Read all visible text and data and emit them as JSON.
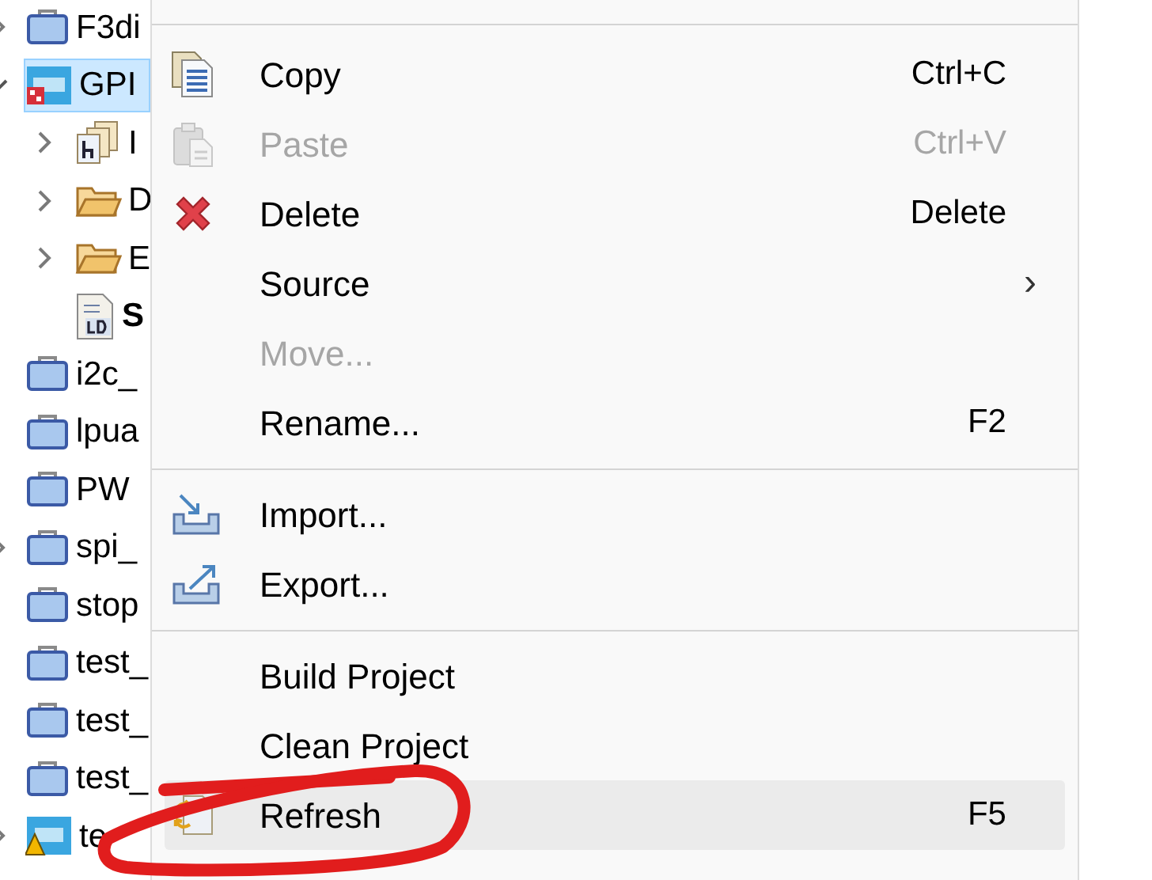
{
  "tree": [
    {
      "label": "F3di",
      "kind": "project",
      "expanded": false
    },
    {
      "label": "GPI",
      "kind": "ide",
      "expanded": true,
      "selected": true,
      "children": [
        {
          "label": "I",
          "kind": "headers",
          "expanded": false
        },
        {
          "label": "D",
          "kind": "folder",
          "expanded": false
        },
        {
          "label": "E",
          "kind": "folder",
          "expanded": false
        },
        {
          "label": "S",
          "kind": "ldfile"
        }
      ]
    },
    {
      "label": "i2c_",
      "kind": "project"
    },
    {
      "label": "lpua",
      "kind": "project"
    },
    {
      "label": "PW",
      "kind": "project"
    },
    {
      "label": "spi_",
      "kind": "project",
      "expanded": false
    },
    {
      "label": "stop",
      "kind": "project"
    },
    {
      "label": "test_",
      "kind": "project"
    },
    {
      "label": "test_",
      "kind": "project"
    },
    {
      "label": "test_",
      "kind": "project"
    },
    {
      "label": "te",
      "kind": "ide_warning",
      "expanded": false
    }
  ],
  "context_menu": [
    {
      "kind": "item",
      "label": "Copy",
      "shortcut": "Ctrl+C",
      "disabled": false,
      "selected": false
    },
    {
      "kind": "item",
      "label": "Paste",
      "shortcut": "Ctrl+V",
      "disabled": true,
      "selected": false
    },
    {
      "kind": "item",
      "label": "Delete",
      "shortcut": "Delete",
      "disabled": false,
      "selected": false
    },
    {
      "kind": "submenu",
      "label": "Source",
      "arrow": "›",
      "disabled": false,
      "selected": false
    },
    {
      "kind": "item",
      "label": "Move...",
      "disabled": true,
      "selected": false
    },
    {
      "kind": "item",
      "label": "Rename...",
      "shortcut": "F2",
      "disabled": false,
      "selected": false
    },
    {
      "kind": "separator"
    },
    {
      "kind": "item",
      "label": "Import...",
      "disabled": false,
      "selected": false
    },
    {
      "kind": "item",
      "label": "Export...",
      "disabled": false,
      "selected": false
    },
    {
      "kind": "separator"
    },
    {
      "kind": "item",
      "label": "Build Project",
      "disabled": false,
      "selected": false
    },
    {
      "kind": "item",
      "label": "Clean Project",
      "disabled": false,
      "selected": false
    },
    {
      "kind": "item",
      "label": "Refresh",
      "shortcut": "F5",
      "disabled": false,
      "selected": true
    }
  ],
  "annotations": [
    {
      "kind": "ellipse"
    }
  ]
}
